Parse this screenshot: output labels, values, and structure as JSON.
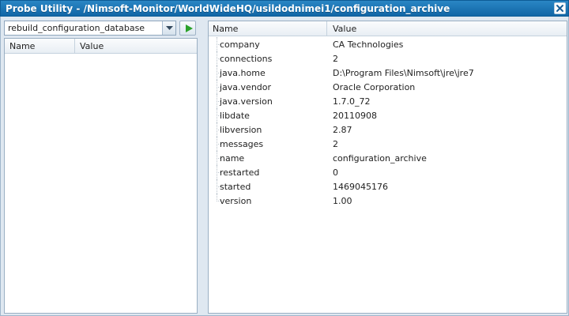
{
  "window": {
    "title": "Probe Utility - /Nimsoft-Monitor/WorldWideHQ/usildodnimei1/configuration_archive"
  },
  "command": {
    "selected": "rebuild_configuration_database"
  },
  "left_table": {
    "headers": [
      "Name",
      "Value"
    ]
  },
  "right_table": {
    "headers": [
      "Name",
      "Value"
    ],
    "rows": [
      {
        "name": "company",
        "value": "CA Technologies"
      },
      {
        "name": "connections",
        "value": "2"
      },
      {
        "name": "java.home",
        "value": "D:\\Program Files\\Nimsoft\\jre\\jre7"
      },
      {
        "name": "java.vendor",
        "value": "Oracle Corporation"
      },
      {
        "name": "java.version",
        "value": "1.7.0_72"
      },
      {
        "name": "libdate",
        "value": "20110908"
      },
      {
        "name": "libversion",
        "value": "2.87"
      },
      {
        "name": "messages",
        "value": "2"
      },
      {
        "name": "name",
        "value": "configuration_archive"
      },
      {
        "name": "restarted",
        "value": "0"
      },
      {
        "name": "started",
        "value": "1469045176"
      },
      {
        "name": "version",
        "value": "1.00"
      }
    ]
  },
  "icons": {
    "close": "close-icon",
    "dropdown": "chevron-down-icon",
    "run": "play-icon"
  },
  "colors": {
    "titlebar": "#1a78b8",
    "run_icon": "#2aa12a"
  }
}
